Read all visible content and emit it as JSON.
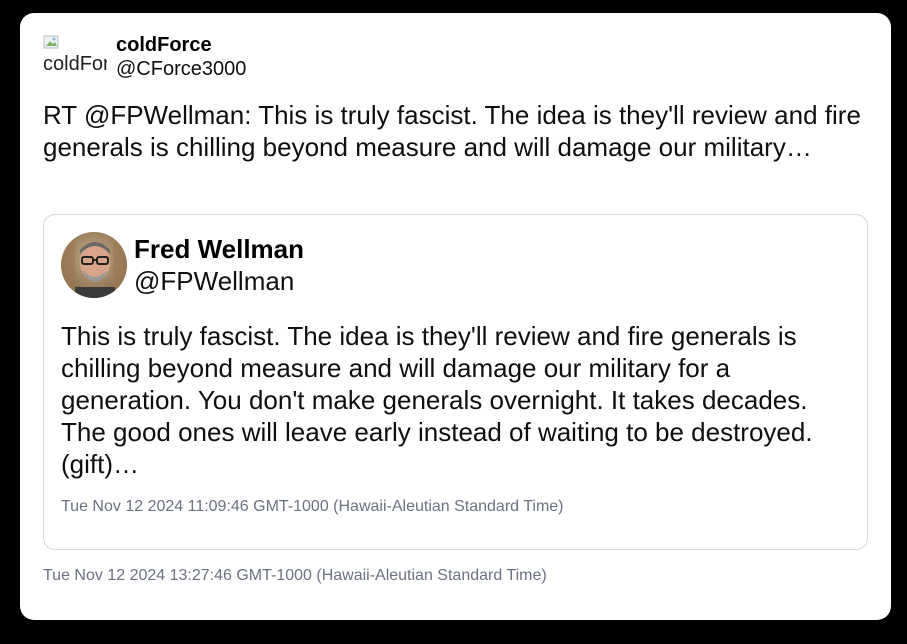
{
  "tweet": {
    "author": {
      "display_name": "coldForce",
      "handle": "@CForce3000",
      "avatar_alt": "coldForce",
      "avatar_icon": "broken-image-icon"
    },
    "text": "RT @FPWellman: This is truly fascist. The idea is they'll review and fire generals is chilling beyond measure and will damage our military…",
    "timestamp": "Tue Nov 12 2024 13:27:46 GMT-1000 (Hawaii-Aleutian Standard Time)"
  },
  "quoted_tweet": {
    "author": {
      "display_name": "Fred Wellman",
      "handle": "@FPWellman"
    },
    "text": "This is truly fascist. The idea is they'll review and fire generals is chilling beyond measure and will damage our military for a generation. You don't make generals overnight. It takes decades. The good ones will leave early instead of waiting to be destroyed. (gift)…",
    "timestamp": "Tue Nov 12 2024 11:09:46 GMT-1000 (Hawaii-Aleutian Standard Time)"
  },
  "colors": {
    "background": "#000000",
    "card": "#ffffff",
    "border": "#d6d9dc",
    "muted_text": "#6b7280"
  }
}
